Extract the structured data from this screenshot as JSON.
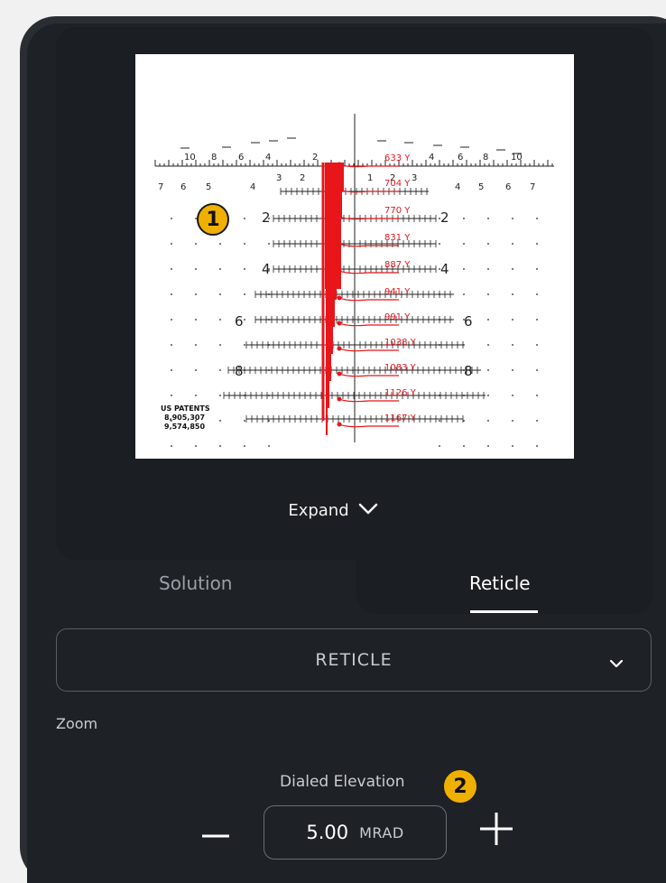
{
  "reticle_image": {
    "top_scale": [
      "10",
      "8",
      "6",
      "4",
      "2",
      "4",
      "6",
      "8",
      "10"
    ],
    "second_row": [
      "7",
      "6",
      "5",
      "4",
      "3",
      "2",
      "1",
      "2",
      "3",
      "4",
      "5",
      "6",
      "7"
    ],
    "side_numbers": [
      "2",
      "4",
      "6",
      "8"
    ],
    "distance_labels": [
      "633 Y",
      "704 Y",
      "770 Y",
      "831 Y",
      "887 Y",
      "941 Y",
      "991 Y",
      "1038 Y",
      "1083 Y",
      "1126 Y",
      "1167 Y"
    ],
    "patents_title": "US PATENTS",
    "patent_1": "8,905,307",
    "patent_2": "9,574,850"
  },
  "expand": {
    "label": "Expand",
    "icon": "chevron-down-icon"
  },
  "tabs": [
    {
      "label": "Solution",
      "active": false
    },
    {
      "label": "Reticle",
      "active": true
    }
  ],
  "reticle_select": {
    "value": "RETICLE"
  },
  "zoom_label": "Zoom",
  "elevation": {
    "label": "Dialed Elevation",
    "value": "5.00",
    "unit": "MRAD"
  },
  "badges": {
    "one": "1",
    "two": "2"
  },
  "colors": {
    "accent": "#f0b000",
    "reticle_red": "#e8151b",
    "panel": "#1b1e22"
  }
}
